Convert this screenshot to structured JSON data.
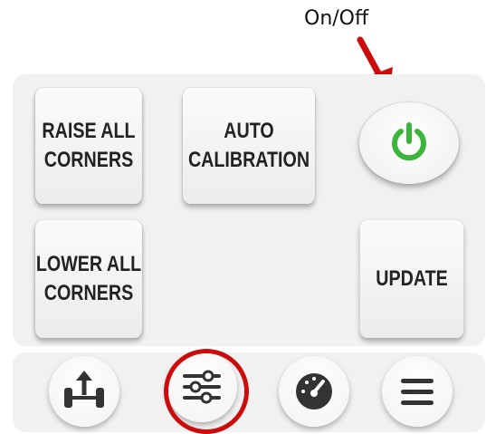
{
  "annotation": {
    "label": "On/Off",
    "highlight_color": "#cc0c0c"
  },
  "controls": {
    "raise_all": {
      "line1": "RAISE ALL",
      "line2": "CORNERS"
    },
    "auto_calibration": {
      "line1": "AUTO",
      "line2": "CALIBRATION"
    },
    "lower_all": {
      "line1": "LOWER ALL",
      "line2": "CORNERS"
    },
    "update": {
      "label": "UPDATE"
    },
    "power": {
      "icon": "power-icon",
      "color": "#39b53a"
    }
  },
  "navbar": {
    "items": [
      {
        "icon": "vehicle-lift-icon"
      },
      {
        "icon": "sliders-icon",
        "highlighted": true
      },
      {
        "icon": "gauge-icon"
      },
      {
        "icon": "menu-icon"
      }
    ]
  }
}
